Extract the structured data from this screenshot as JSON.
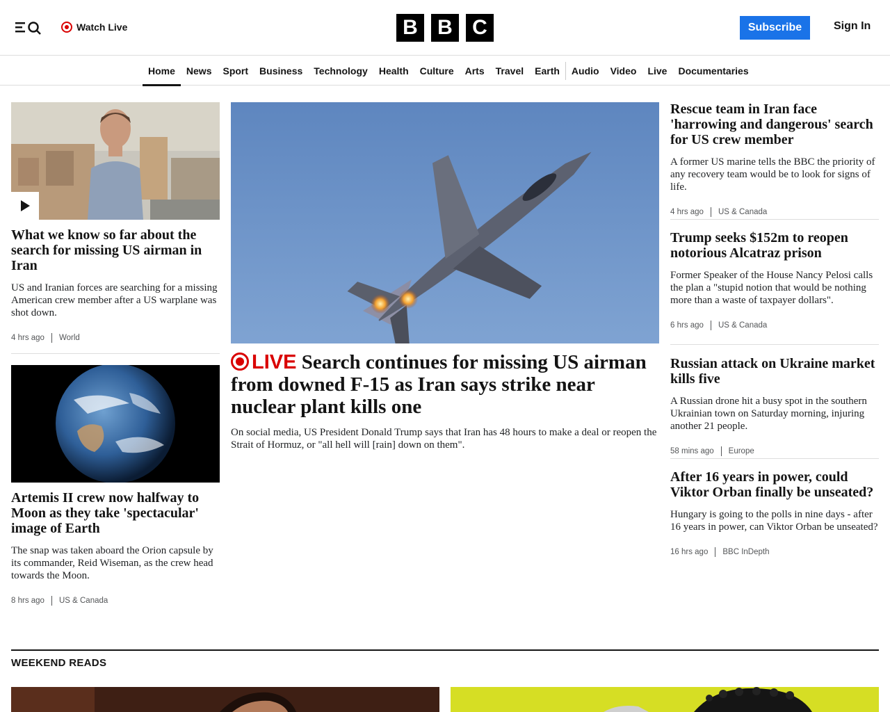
{
  "header": {
    "watch_live": "Watch Live",
    "logo_letters": [
      "B",
      "B",
      "C"
    ],
    "subscribe": "Subscribe",
    "sign_in": "Sign In"
  },
  "nav": {
    "items": [
      "Home",
      "News",
      "Sport",
      "Business",
      "Technology",
      "Health",
      "Culture",
      "Arts",
      "Travel",
      "Earth",
      "Audio",
      "Video",
      "Live",
      "Documentaries"
    ],
    "active": "Home"
  },
  "left_col": [
    {
      "title": "What we know so far about the search for missing US airman in Iran",
      "summary": "US and Iranian forces are searching for a missing American crew member after a US warplane was shot down.",
      "time": "4 hrs ago",
      "section": "World",
      "image": "correspondent-video"
    },
    {
      "title": "Artemis II crew now halfway to Moon as they take 'spectacular' image of Earth",
      "summary": "The snap was taken aboard the Orion capsule by its commander, Reid Wiseman, as the crew head towards the Moon.",
      "time": "8 hrs ago",
      "section": "US & Canada",
      "image": "earth-photo"
    }
  ],
  "hero": {
    "live_label": "LIVE",
    "title": "Search continues for missing US airman from downed F-15 as Iran says strike near nuclear plant kills one",
    "summary": "On social media, US President Donald Trump says that Iran has 48 hours to make a deal or reopen the Strait of Hormuz, or \"all hell will [rain] down on them\".",
    "image": "f15-jet"
  },
  "right_col": [
    {
      "title": "Rescue team in Iran face 'harrowing and dangerous' search for US crew member",
      "summary": "A former US marine tells the BBC the priority of any recovery team would be to look for signs of life.",
      "time": "4 hrs ago",
      "section": "US & Canada"
    },
    {
      "title": "Trump seeks $152m to reopen notorious Alcatraz prison",
      "summary": "Former Speaker of the House Nancy Pelosi calls the plan a \"stupid notion that would be nothing more than a waste of taxpayer dollars\".",
      "time": "6 hrs ago",
      "section": "US & Canada"
    },
    {
      "title": "Russian attack on Ukraine market kills five",
      "summary": "A Russian drone hit a busy spot in the southern Ukrainian town on Saturday morning, injuring another 21 people.",
      "time": "58 mins ago",
      "section": "Europe"
    },
    {
      "title": "After 16 years in power, could Viktor Orban finally be unseated?",
      "summary": "Hungary is going to the polls in nine days - after 16 years in power, can Viktor Orban be unseated?",
      "time": "16 hrs ago",
      "section": "BBC InDepth"
    }
  ],
  "weekend": {
    "title": "WEEKEND READS"
  },
  "colors": {
    "accent_live": "#d90000",
    "subscribe_bg": "#1a73e8",
    "text": "#141414"
  }
}
